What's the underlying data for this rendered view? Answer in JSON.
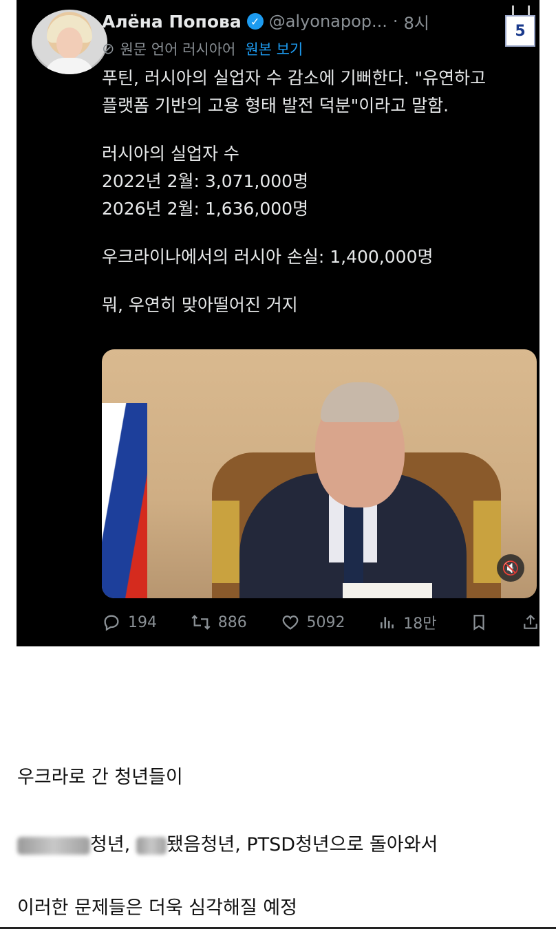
{
  "tweet": {
    "author": {
      "name": "Алёна Попова",
      "handle": "@alyonapop...",
      "separator": "·",
      "time": "8시"
    },
    "translation": {
      "note": "원문 언어 러시아어",
      "link": "원본 보기"
    },
    "text": {
      "line1": "푸틴, 러시아의 실업자 수 감소에 기뻐한다. \"유연하고",
      "line2": "플랫폼 기반의 고용 형태 발전 덕분\"이라고 말함.",
      "line3": "러시아의 실업자 수",
      "line4": "2022년 2월: 3,071,000명",
      "line5": "2026년 2월: 1,636,000명",
      "line6": "우크라이나에서의 러시아 손실: 1,400,000명",
      "line7": "뭐, 우연히 맞아떨어진 거지"
    },
    "stats": {
      "replies": "194",
      "reposts": "886",
      "likes": "5092",
      "views": "18만"
    },
    "icons": {
      "verified": "verified-badge-icon",
      "translate": "globe-off-icon",
      "mute": "mute-icon"
    }
  },
  "badge": {
    "page_number": "5"
  },
  "post_body": {
    "line1": "우크라로 간 청년들이",
    "line2_part1": "청년, ",
    "line2_part2": "됐음청년, PTSD청년으로 돌아와서",
    "line3": "이러한 문제들은 더욱 심각해질 예정"
  },
  "colors": {
    "card_bg": "#000000",
    "link_blue": "#1d9bf0",
    "muted_gray": "#8b9196"
  }
}
